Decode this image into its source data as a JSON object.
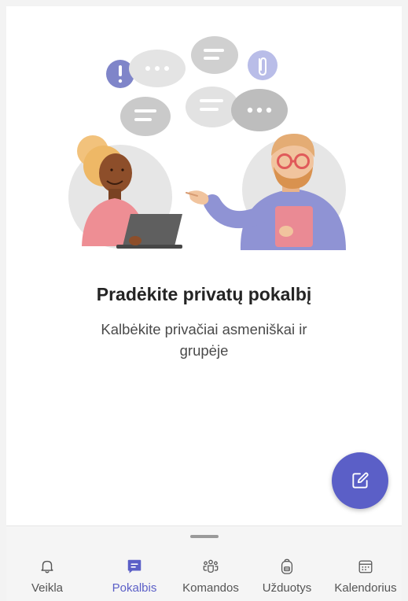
{
  "empty_state": {
    "title": "Pradėkite privatų pokalbį",
    "subtitle": "Kalbėkite privačiai asmeniškai ir grupėje"
  },
  "fab": {
    "icon": "compose-icon"
  },
  "bottom_nav": {
    "active": "Pokalbis",
    "items": [
      {
        "label": "Veikla",
        "icon": "bell-icon"
      },
      {
        "label": "Pokalbis",
        "icon": "chat-icon"
      },
      {
        "label": "Komandos",
        "icon": "teams-icon"
      },
      {
        "label": "Užduotys",
        "icon": "tasks-icon"
      },
      {
        "label": "Kalendorius",
        "icon": "calendar-icon"
      }
    ]
  },
  "colors": {
    "accent": "#5b5fc7",
    "background": "#ffffff",
    "nav_background": "#f5f5f5",
    "text_primary": "#242424",
    "text_secondary": "#4a4a4a"
  }
}
